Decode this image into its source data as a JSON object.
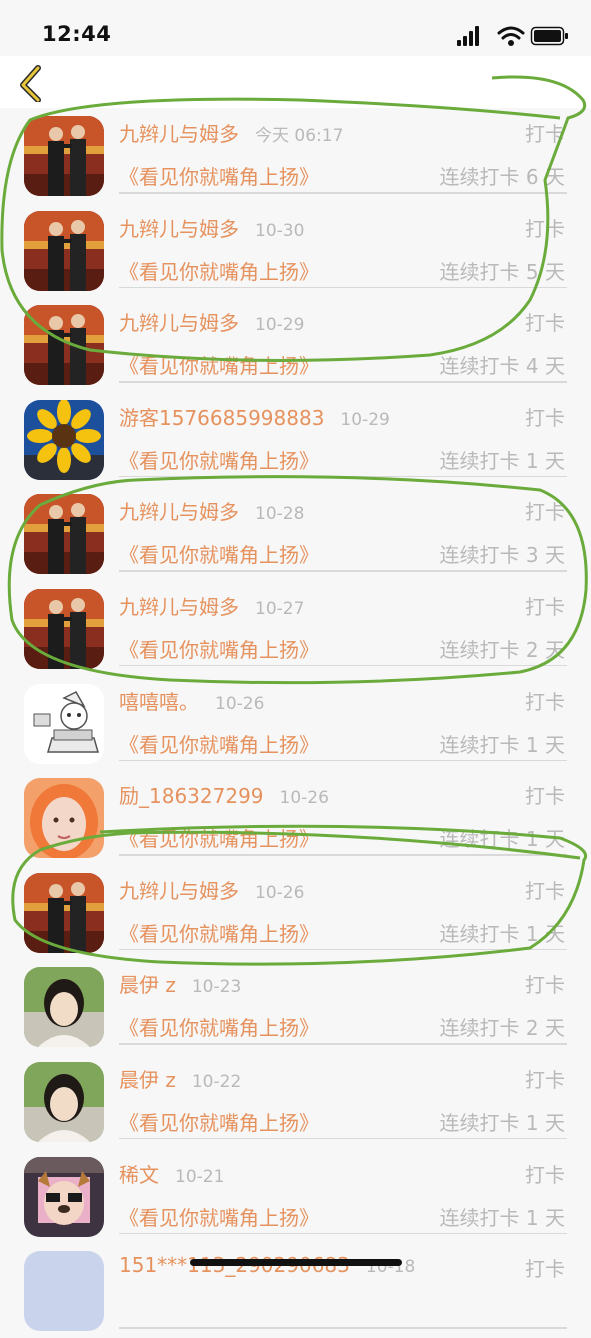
{
  "status_bar": {
    "time": "12:44"
  },
  "colors": {
    "accent": "#e6925e",
    "muted": "#b9b9b9",
    "annotation": "#6aab3c"
  },
  "icons": {
    "back": "chevron-left-icon",
    "signal": "signal-icon",
    "wifi": "wifi-icon",
    "battery": "battery-icon"
  },
  "records": [
    {
      "avatar": "crosstalk-duo",
      "name": "九辫儿与姆多",
      "date": "今天 06:17",
      "action": "打卡",
      "book": "《看见你就嘴角上扬》",
      "streak": "连续打卡 6 天"
    },
    {
      "avatar": "crosstalk-duo",
      "name": "九辫儿与姆多",
      "date": "10-30",
      "action": "打卡",
      "book": "《看见你就嘴角上扬》",
      "streak": "连续打卡 5 天"
    },
    {
      "avatar": "crosstalk-duo",
      "name": "九辫儿与姆多",
      "date": "10-29",
      "action": "打卡",
      "book": "《看见你就嘴角上扬》",
      "streak": "连续打卡 4 天"
    },
    {
      "avatar": "sunflower",
      "name": "游客1576685998883",
      "date": "10-29",
      "action": "打卡",
      "book": "《看见你就嘴角上扬》",
      "streak": "连续打卡 1 天"
    },
    {
      "avatar": "crosstalk-duo",
      "name": "九辫儿与姆多",
      "date": "10-28",
      "action": "打卡",
      "book": "《看见你就嘴角上扬》",
      "streak": "连续打卡 3 天"
    },
    {
      "avatar": "crosstalk-duo",
      "name": "九辫儿与姆多",
      "date": "10-27",
      "action": "打卡",
      "book": "《看见你就嘴角上扬》",
      "streak": "连续打卡 2 天"
    },
    {
      "avatar": "cartoon-laptop",
      "name": "嘻嘻嘻。",
      "date": "10-26",
      "action": "打卡",
      "book": "《看见你就嘴角上扬》",
      "streak": "连续打卡 1 天"
    },
    {
      "avatar": "orange-hood",
      "name": "励_186327299",
      "date": "10-26",
      "action": "打卡",
      "book": "《看见你就嘴角上扬》",
      "streak": "连续打卡 1 天"
    },
    {
      "avatar": "crosstalk-duo",
      "name": "九辫儿与姆多",
      "date": "10-26",
      "action": "打卡",
      "book": "《看见你就嘴角上扬》",
      "streak": "连续打卡 1 天"
    },
    {
      "avatar": "girl-portrait",
      "name": "晨伊 z",
      "date": "10-23",
      "action": "打卡",
      "book": "《看见你就嘴角上扬》",
      "streak": "连续打卡 2 天"
    },
    {
      "avatar": "girl-portrait",
      "name": "晨伊 z",
      "date": "10-22",
      "action": "打卡",
      "book": "《看见你就嘴角上扬》",
      "streak": "连续打卡 1 天"
    },
    {
      "avatar": "dog-filter",
      "name": "稀文",
      "date": "10-21",
      "action": "打卡",
      "book": "《看见你就嘴角上扬》",
      "streak": "连续打卡 1 天"
    },
    {
      "avatar": "blank",
      "name": "151***113_290290683",
      "date": "10-18",
      "action": "打卡",
      "book": "",
      "streak": ""
    }
  ]
}
